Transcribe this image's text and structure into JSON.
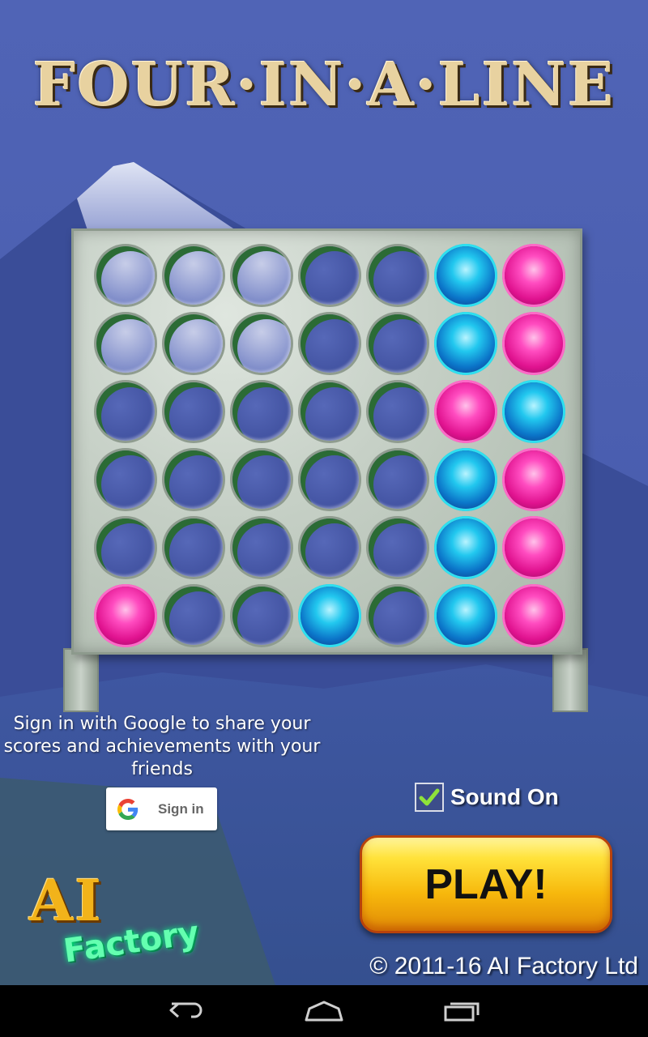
{
  "title": "FOUR·IN·A·LINE",
  "board": {
    "rows": [
      [
        "empty",
        "empty",
        "empty",
        "empty",
        "empty",
        "blue",
        "pink"
      ],
      [
        "empty",
        "empty",
        "empty",
        "empty",
        "empty",
        "blue",
        "pink"
      ],
      [
        "empty",
        "empty",
        "empty",
        "empty",
        "empty",
        "pink",
        "blue"
      ],
      [
        "empty",
        "empty",
        "empty",
        "empty",
        "empty",
        "blue",
        "pink"
      ],
      [
        "empty",
        "empty",
        "empty",
        "empty",
        "empty",
        "blue",
        "pink"
      ],
      [
        "pink",
        "empty",
        "empty",
        "blue",
        "empty",
        "blue",
        "pink"
      ]
    ],
    "colors": {
      "pink": "#e0128f",
      "blue": "#0b74c8"
    }
  },
  "signin": {
    "message": "Sign in with Google to share your scores and achievements with your friends",
    "button_label": "Sign in",
    "icon": "google-g-icon"
  },
  "sound": {
    "label": "Sound On",
    "checked": true
  },
  "play": {
    "label": "PLAY!"
  },
  "logo": {
    "line1": "AI",
    "line2": "Factory"
  },
  "copyright": "© 2011-16 AI Factory Ltd",
  "navbar": {
    "icons": [
      "back-icon",
      "home-icon",
      "recent-apps-icon"
    ]
  }
}
